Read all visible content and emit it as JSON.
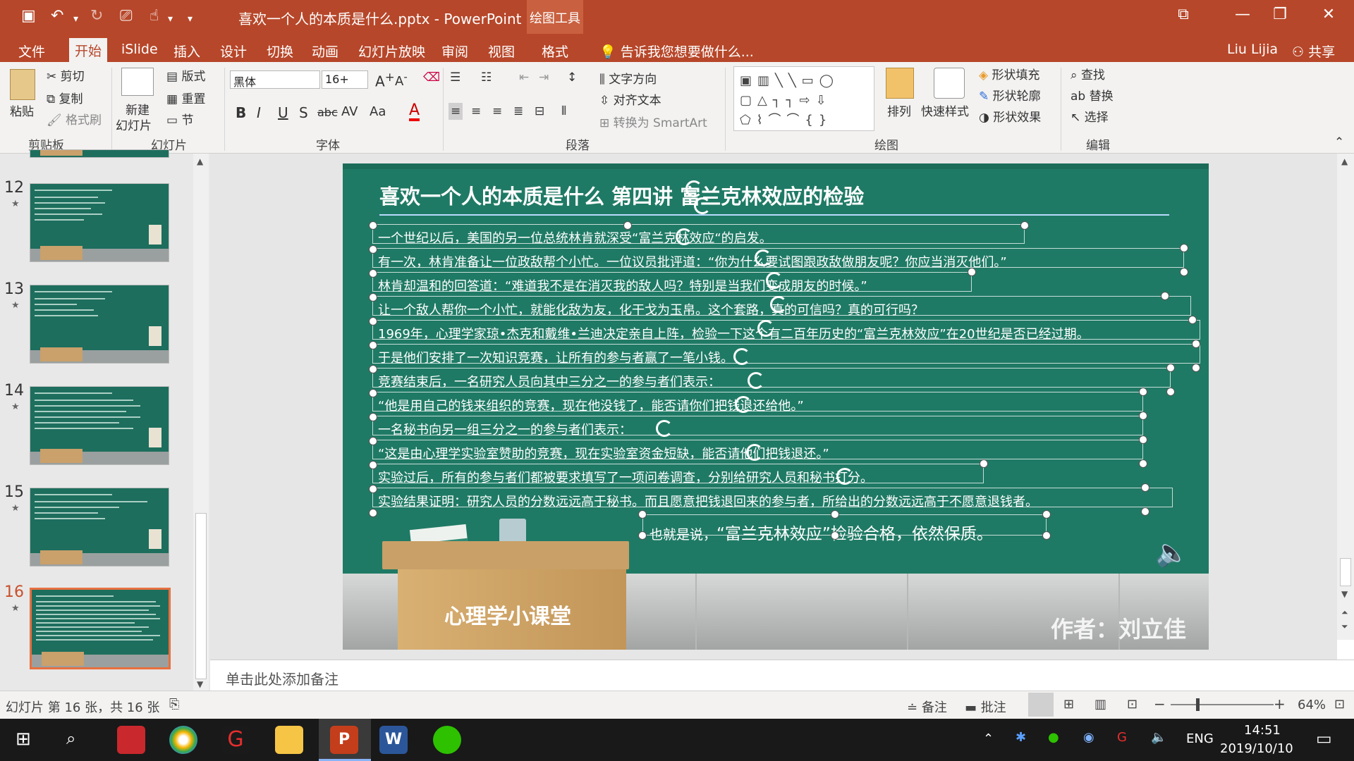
{
  "window": {
    "title": "喜欢一个人的本质是什么.pptx - PowerPoint",
    "context_tab": "绘图工具",
    "user": "Liu Lijia",
    "share": "共享"
  },
  "tabs": [
    "文件",
    "开始",
    "iSlide",
    "插入",
    "设计",
    "切换",
    "动画",
    "幻灯片放映",
    "审阅",
    "视图",
    "格式"
  ],
  "active_tab": "开始",
  "tell_me": "告诉我您想要做什么...",
  "ribbon": {
    "clipboard": {
      "paste": "粘贴",
      "cut": "剪切",
      "copy": "复制",
      "format_painter": "格式刷",
      "label": "剪贴板"
    },
    "slides": {
      "new_slide": "新建",
      "new_slide2": "幻灯片",
      "layout": "版式",
      "reset": "重置",
      "section": "节",
      "label": "幻灯片"
    },
    "font": {
      "name": "黑体",
      "size": "16+",
      "label": "字体"
    },
    "paragraph": {
      "text_direction": "文字方向",
      "align_text": "对齐文本",
      "smartart": "转换为 SmartArt",
      "label": "段落"
    },
    "drawing": {
      "arrange": "排列",
      "quick_styles": "快速样式",
      "fill": "形状填充",
      "outline": "形状轮廓",
      "effects": "形状效果",
      "label": "绘图"
    },
    "editing": {
      "find": "查找",
      "replace": "替换",
      "select": "选择",
      "label": "编辑"
    }
  },
  "thumbnails": [
    {
      "num": "12"
    },
    {
      "num": "13"
    },
    {
      "num": "14"
    },
    {
      "num": "15"
    },
    {
      "num": "16"
    }
  ],
  "slide": {
    "title": "喜欢一个人的本质是什么  第四讲  富兰克林效应的检验",
    "lines": [
      "一个世纪以后，美国的另一位总统林肯就深受“富兰克林效应“的启发。",
      "有一次，林肯准备让一位政敌帮个小忙。一位议员批评道：“你为什么要试图跟政敌做朋友呢？你应当消灭他们。”",
      "林肯却温和的回答道：“难道我不是在消灭我的敌人吗？特别是当我们变成朋友的时候。”",
      "让一个敌人帮你一个小忙，就能化敌为友，化干戈为玉帛。这个套路，真的可信吗？真的可行吗？",
      "1969年，心理学家琼•杰克和戴维•兰迪决定亲自上阵，检验一下这个有二百年历史的“富兰克林效应”在20世纪是否已经过期。",
      "于是他们安排了一次知识竞赛，让所有的参与者赢了一笔小钱。",
      "竞赛结束后，一名研究人员向其中三分之一的参与者们表示：",
      "“他是用自己的钱来组织的竞赛，现在他没钱了，能否请你们把钱退还给他。”",
      "一名秘书向另一组三分之一的参与者们表示：",
      "“这是由心理学实验室赞助的竞赛，现在实验室资金短缺，能否请他们把钱退还。”",
      "实验过后，所有的参与者们都被要求填写了一项问卷调查，分别给研究人员和秘书打分。",
      "实验结果证明：研究人员的分数远远高于秘书。而且愿意把钱退回来的参与者，所给出的分数远远高于不愿意退钱者。"
    ],
    "conclusion_prefix": "也就是说，",
    "conclusion_main": "“富兰克林效应”检验合格，依然保质。",
    "desk_label": "心理学小课堂",
    "author": "作者：刘立佳"
  },
  "notes_placeholder": "单击此处添加备注",
  "status": {
    "slide_info": "幻灯片 第 16 张，共 16 张",
    "notes": "备注",
    "comments": "批注",
    "zoom": "64%"
  },
  "taskbar": {
    "lang": "ENG",
    "time": "14:51",
    "date": "2019/10/10"
  },
  "colors": {
    "accent": "#b7472a",
    "slide_bg": "#1f7a65"
  }
}
